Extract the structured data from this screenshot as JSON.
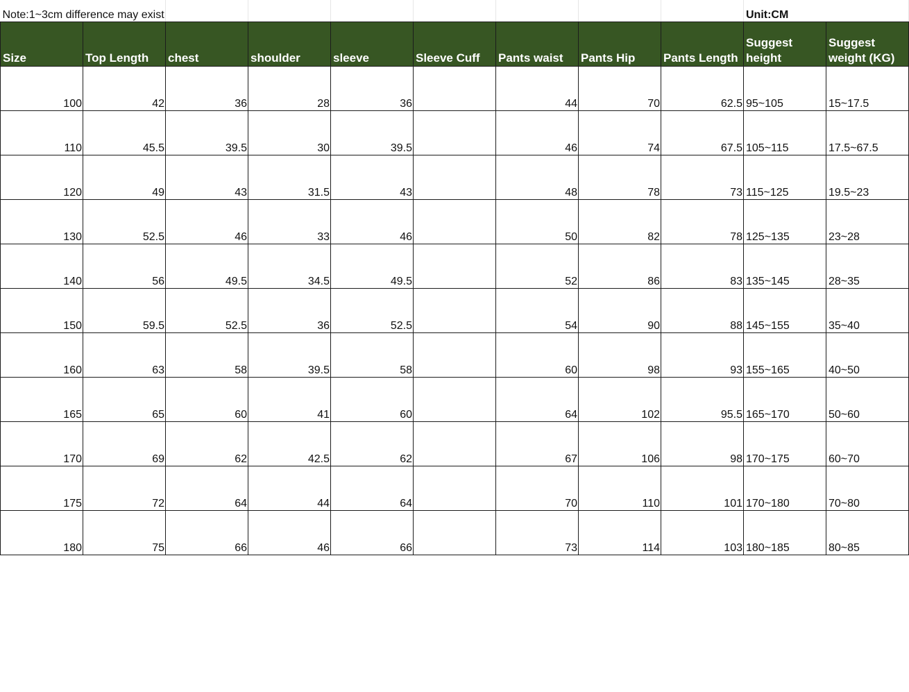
{
  "note": "Note:1~3cm difference may exist.",
  "unit": "Unit:CM",
  "columns": [
    {
      "label": "Size",
      "key": "size"
    },
    {
      "label": "Top Length",
      "key": "top_length"
    },
    {
      "label": "chest",
      "key": "chest"
    },
    {
      "label": "shoulder",
      "key": "shoulder"
    },
    {
      "label": "sleeve",
      "key": "sleeve"
    },
    {
      "label": "Sleeve Cuff",
      "key": "sleeve_cuff"
    },
    {
      "label": "Pants waist",
      "key": "pants_waist"
    },
    {
      "label": "Pants Hip",
      "key": "pants_hip"
    },
    {
      "label": "Pants Length",
      "key": "pants_length"
    },
    {
      "label": "Suggest height",
      "key": "suggest_height"
    },
    {
      "label": "Suggest weight (KG)",
      "key": "suggest_weight"
    }
  ],
  "rows": [
    [
      "100",
      "42",
      "36",
      "28",
      "36",
      "",
      "44",
      "70",
      "62.5",
      "95~105",
      "15~17.5"
    ],
    [
      "110",
      "45.5",
      "39.5",
      "30",
      "39.5",
      "",
      "46",
      "74",
      "67.5",
      "105~115",
      "17.5~67.5"
    ],
    [
      "120",
      "49",
      "43",
      "31.5",
      "43",
      "",
      "48",
      "78",
      "73",
      "115~125",
      "19.5~23"
    ],
    [
      "130",
      "52.5",
      "46",
      "33",
      "46",
      "",
      "50",
      "82",
      "78",
      "125~135",
      "23~28"
    ],
    [
      "140",
      "56",
      "49.5",
      "34.5",
      "49.5",
      "",
      "52",
      "86",
      "83",
      "135~145",
      "28~35"
    ],
    [
      "150",
      "59.5",
      "52.5",
      "36",
      "52.5",
      "",
      "54",
      "90",
      "88",
      "145~155",
      "35~40"
    ],
    [
      "160",
      "63",
      "58",
      "39.5",
      "58",
      "",
      "60",
      "98",
      "93",
      "155~165",
      "40~50"
    ],
    [
      "165",
      "65",
      "60",
      "41",
      "60",
      "",
      "64",
      "102",
      "95.5",
      "165~170",
      "50~60"
    ],
    [
      "170",
      "69",
      "62",
      "42.5",
      "62",
      "",
      "67",
      "106",
      "98",
      "170~175",
      "60~70"
    ],
    [
      "175",
      "72",
      "64",
      "44",
      "64",
      "",
      "70",
      "110",
      "101",
      "170~180",
      "70~80"
    ],
    [
      "180",
      "75",
      "66",
      "46",
      "66",
      "",
      "73",
      "114",
      "103",
      "180~185",
      "80~85"
    ]
  ],
  "colors": {
    "header_bg": "#375623",
    "header_text": "#ffffff",
    "grid": "#1c1c1c"
  }
}
